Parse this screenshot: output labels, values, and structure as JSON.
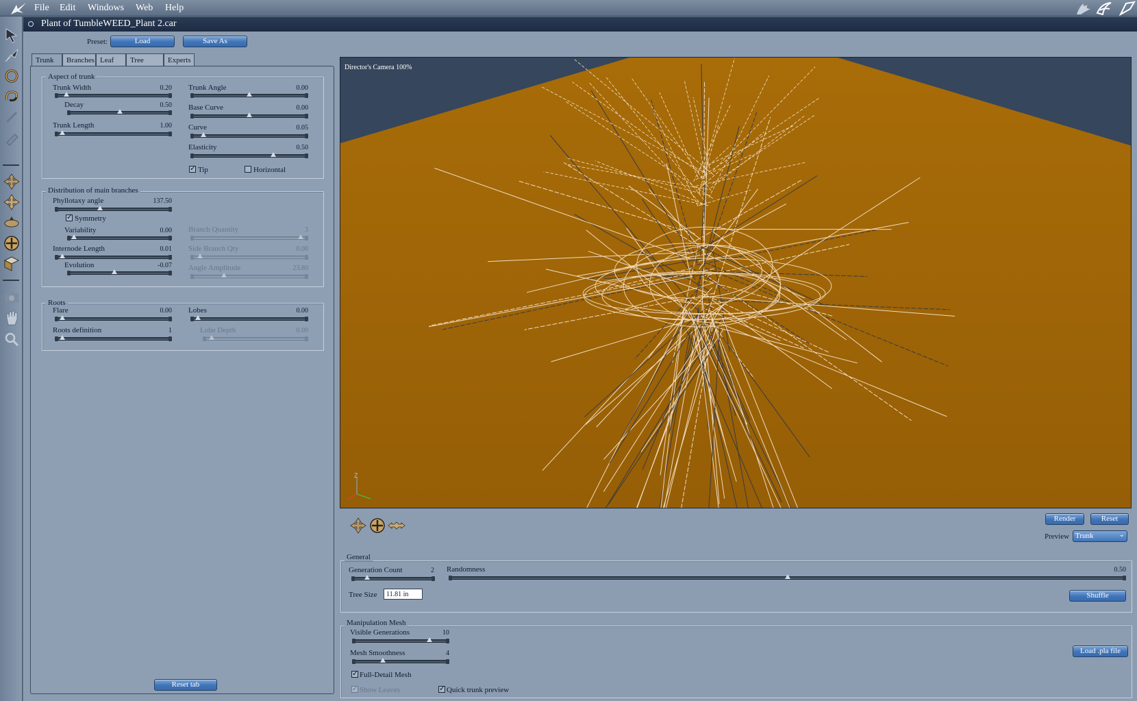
{
  "menu": {
    "items": [
      "File",
      "Edit",
      "Windows",
      "Web",
      "Help"
    ]
  },
  "titlebar": {
    "title": "Plant of TumbleWEED_Plant 2.car"
  },
  "preset": {
    "label": "Preset:",
    "load": "Load",
    "save_as": "Save As"
  },
  "tabs": [
    "Trunk",
    "Branches",
    "Leaf",
    "Tree shape",
    "Experts"
  ],
  "trunk": {
    "aspect": {
      "title": "Aspect of trunk",
      "trunk_width": {
        "label": "Trunk Width",
        "value": "0.20",
        "pos": 0.07
      },
      "decay": {
        "label": "Decay",
        "value": "0.50",
        "pos": 0.5
      },
      "trunk_length": {
        "label": "Trunk Length",
        "value": "1.00",
        "pos": 0.03
      },
      "trunk_angle": {
        "label": "Trunk Angle",
        "value": "0.00",
        "pos": 0.5
      },
      "base_curve": {
        "label": "Base Curve",
        "value": "0.00",
        "pos": 0.5
      },
      "curve": {
        "label": "Curve",
        "value": "0.05",
        "pos": 0.08
      },
      "elasticity": {
        "label": "Elasticity",
        "value": "0.50",
        "pos": 0.72
      },
      "tip": {
        "label": "Tip",
        "checked": true
      },
      "horizontal": {
        "label": "Horizontal",
        "checked": false
      }
    },
    "distribution": {
      "title": "Distribution of main branches",
      "phyllotaxy": {
        "label": "Phyllotaxy angle",
        "value": "137.50",
        "pos": 0.38
      },
      "symmetry": {
        "label": "Symmetry",
        "checked": true
      },
      "variability": {
        "label": "Variability",
        "value": "0.00",
        "pos": 0.03
      },
      "internode": {
        "label": "Internode Length",
        "value": "0.01",
        "pos": 0.03
      },
      "evolution": {
        "label": "Evolution",
        "value": "-0.07",
        "pos": 0.45
      },
      "branch_quantity": {
        "label": "Branch Quantity",
        "value": "3",
        "pos": 0.97
      },
      "side_branch_qty": {
        "label": "Side Branch Qty",
        "value": "0.00",
        "pos": 0.05
      },
      "angle_amplitude": {
        "label": "Angle Amplitude",
        "value": "23.80",
        "pos": 0.27
      }
    },
    "roots": {
      "title": "Roots",
      "flare": {
        "label": "Flare",
        "value": "0.00",
        "pos": 0.03
      },
      "roots_definition": {
        "label": "Roots definition",
        "value": "1",
        "pos": 0.03
      },
      "lobes": {
        "label": "Lobes",
        "value": "0.00",
        "pos": 0.03
      },
      "lobe_depth": {
        "label": "Lobe Depth",
        "value": "0.00",
        "pos": 0.05
      }
    },
    "reset_tab": "Reset tab"
  },
  "viewport": {
    "camera_label": "Director's Camera 100%",
    "axis_label": "Z"
  },
  "render": {
    "render": "Render",
    "reset": "Reset",
    "preview_label": "Preview",
    "preview_value": "Trunk"
  },
  "general": {
    "title": "General",
    "generation_count": {
      "label": "Generation Count",
      "value": "2",
      "pos": 0.15
    },
    "randomness": {
      "label": "Randomness",
      "value": "0.50",
      "pos": 0.5
    },
    "tree_size": {
      "label": "Tree Size",
      "value": "11.81 in"
    },
    "shuffle": "Shuffle"
  },
  "mesh": {
    "title": "Manipulation Mesh",
    "visible_generations": {
      "label": "Visible Generations",
      "value": "10",
      "pos": 0.82
    },
    "mesh_smoothness": {
      "label": "Mesh Smoothness",
      "value": "4",
      "pos": 0.3
    },
    "full_detail": {
      "label": "Full-Detail Mesh",
      "checked": true
    },
    "show_leaves": {
      "label": "Show Leaves",
      "checked": true
    },
    "quick_trunk": {
      "label": "Quick trunk preview",
      "checked": true
    },
    "load_pla": "Load .pla file"
  },
  "colors": {
    "accent": "#3f74b8",
    "ground": "#9a6206",
    "sky": "#36465c"
  }
}
